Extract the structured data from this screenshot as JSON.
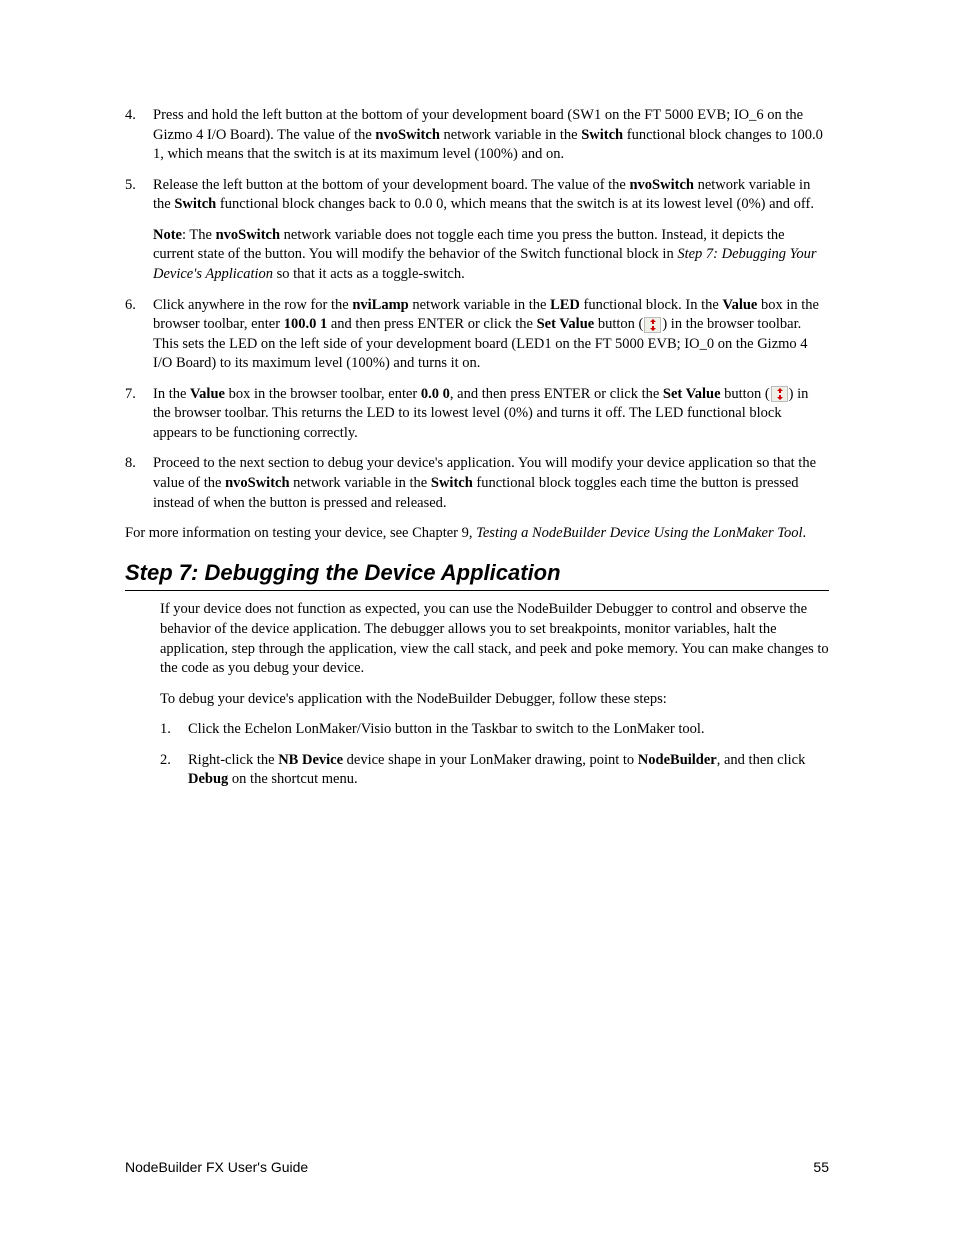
{
  "list4": {
    "num": "4.",
    "text": "Press and hold the left button at the bottom of your development board (SW1 on the FT 5000 EVB; IO_6 on the Gizmo 4 I/O Board).  The value of the ",
    "bold1": "nvoSwitch",
    "text2": " network variable in the ",
    "bold2": "Switch",
    "text3": " functional block changes to 100.0 1, which means that the switch is at its maximum level (100%) and on."
  },
  "list5": {
    "num": "5.",
    "p1_t1": "Release the left button at the bottom of your development board.  The value of the ",
    "p1_b1": "nvoSwitch",
    "p1_t2": " network variable in the ",
    "p1_b2": "Switch",
    "p1_t3": " functional block changes back to 0.0 0, which means that the switch is at its lowest level (0%) and off.",
    "p2_b1": "Note",
    "p2_t1": ":  The ",
    "p2_b2": "nvoSwitch",
    "p2_t2": " network variable does not toggle each time you press the button.  Instead, it depicts the current state of the button.  You will modify the behavior of the Switch functional block in ",
    "p2_i1": "Step 7: Debugging Your Device's Application",
    "p2_t3": " so that it acts as a toggle-switch."
  },
  "list6": {
    "num": "6.",
    "t1": "Click anywhere in the row for the ",
    "b1": "nviLamp",
    "t2": " network variable in the ",
    "b2": "LED",
    "t3": " functional block.  In the ",
    "b3": "Value",
    "t4": " box in the browser toolbar, enter ",
    "b4": "100.0 1",
    "t5": " and then press ENTER or click the ",
    "b5": "Set Value",
    "t6": " button (",
    "t7": ") in the browser toolbar.  This sets the LED on the left side of your development board (LED1 on the FT 5000 EVB; IO_0 on the Gizmo 4 I/O Board) to its maximum level (100%) and turns it on."
  },
  "list7": {
    "num": "7.",
    "t1": "In the ",
    "b1": "Value",
    "t2": " box in the browser toolbar, enter ",
    "b2": "0.0 0",
    "t3": ", and then press ENTER or click the ",
    "b3": "Set Value",
    "t4": " button (",
    "t5": ") in the browser toolbar.  This returns the LED to its lowest level (0%) and turns it off.  The LED functional block appears to be functioning correctly."
  },
  "list8": {
    "num": "8.",
    "t1": "Proceed to the next section to debug your device's application.  You will modify your device application so that the value of the ",
    "b1": "nvoSwitch",
    "t2": " network variable in the ",
    "b2": "Switch",
    "t3": " functional block toggles each time the button is pressed instead of when the button is pressed and released."
  },
  "afterList": {
    "t1": "For more information on testing your device, see Chapter 9, ",
    "i1": "Testing a NodeBuilder Device Using the LonMaker Tool",
    "t2": "."
  },
  "heading": "Step 7: Debugging the Device Application",
  "sectionP1": "If your device does not function as expected, you can use the NodeBuilder Debugger to control and observe the behavior of the device application.  The debugger allows you to set breakpoints, monitor variables, halt the application, step through the application, view the call stack, and peek and poke memory.  You can make changes to the code as you debug your device.",
  "sectionP2": "To debug your device's application with the NodeBuilder Debugger, follow these steps:",
  "sub1": {
    "num": "1.",
    "text": "Click the Echelon LonMaker/Visio button in the Taskbar to switch to the LonMaker tool."
  },
  "sub2": {
    "num": "2.",
    "t1": "Right-click the ",
    "b1": "NB Device",
    "t2": " device shape in your LonMaker drawing, point to ",
    "b2": "NodeBuilder",
    "t3": ", and then click ",
    "b3": "Debug",
    "t4": " on the shortcut menu."
  },
  "footer": {
    "left": "NodeBuilder FX User's Guide",
    "right": "55"
  }
}
